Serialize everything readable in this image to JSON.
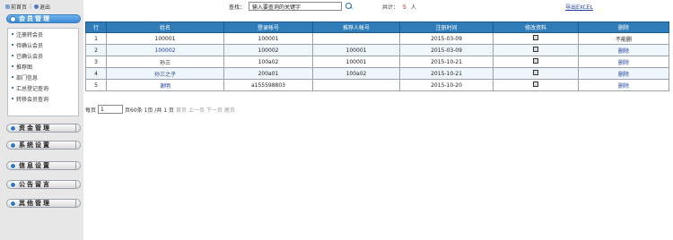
{
  "topbar": {
    "home": "前首页",
    "exit": "退出"
  },
  "menus": {
    "member": "会员管理",
    "member_items": [
      "注册转会员",
      "待确认会员",
      "已确认会员",
      "推荐图",
      "部门信息",
      "汇总登记查询",
      "转移会员查询"
    ],
    "fund": "资金管理",
    "system": "系统设置",
    "info": "信息设置",
    "notice": "公告留言",
    "other": "其他管理"
  },
  "search": {
    "label": "查找：",
    "placeholder": "输入要查询的关键字",
    "value": "输入要查询的关键字"
  },
  "total": {
    "label": "共计：",
    "count": "5",
    "unit": "人"
  },
  "export_link": "导出EXCEL",
  "table": {
    "headers": [
      "行",
      "姓名",
      "登录帐号",
      "推荐人帐号",
      "注册时间",
      "修改资料",
      "删除"
    ],
    "rows": [
      {
        "no": "1",
        "name": "100001",
        "account": "100001",
        "referrer": "",
        "time": "2015-03-09",
        "delete": "不能删"
      },
      {
        "no": "2",
        "name": "100002",
        "account": "100002",
        "referrer": "100001",
        "time": "2015-03-09",
        "delete": "删除"
      },
      {
        "no": "3",
        "name": "孙三",
        "account": "100a02",
        "referrer": "100001",
        "time": "2015-10-21",
        "delete": "删除"
      },
      {
        "no": "4",
        "name": "孙三之子",
        "account": "200a01",
        "referrer": "100a02",
        "time": "2015-10-21",
        "delete": "删除"
      },
      {
        "no": "5",
        "name": "谢明",
        "account": "a155598803",
        "referrer": "",
        "time": "2015-10-20",
        "delete": "删除"
      }
    ]
  },
  "pager": {
    "prefix": "每页",
    "page_size": "1",
    "summary": "页60条 1页 /共 1 页",
    "first": "首页",
    "prev": "上一页",
    "next": "下一页",
    "last": "尾页"
  }
}
